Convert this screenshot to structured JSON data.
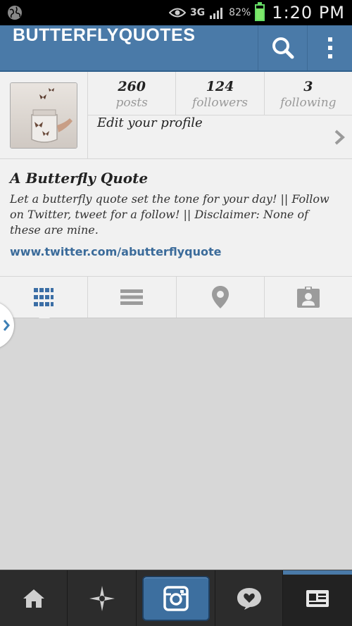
{
  "status_bar": {
    "network": "3G",
    "battery": "82%",
    "battery_level": 0.82,
    "time": "1:20 PM",
    "icons": [
      "globe-icon",
      "eye-icon",
      "signal-icon",
      "battery-icon"
    ]
  },
  "header": {
    "title": "BUTTERFLYQUOTES",
    "color": "#4a7aa8",
    "icons": [
      "search-icon",
      "overflow-menu-icon"
    ]
  },
  "profile": {
    "stats": [
      {
        "value": "260",
        "label": "posts"
      },
      {
        "value": "124",
        "label": "followers"
      },
      {
        "value": "3",
        "label": "following"
      }
    ],
    "edit_label": "Edit your profile",
    "name": "A Butterfly Quote",
    "bio": "Let a butterfly quote set the tone for your day! || Follow on Twitter, tweet for a follow! || Disclaimer: None of these are mine.",
    "link": "www.twitter.com/abutterflyquote"
  },
  "tabs": [
    {
      "icon": "grid-view-icon",
      "active": true
    },
    {
      "icon": "list-view-icon",
      "active": false
    },
    {
      "icon": "map-pin-icon",
      "active": false
    },
    {
      "icon": "tagged-photos-icon",
      "active": false
    }
  ],
  "bottom_nav": [
    {
      "icon": "home-icon"
    },
    {
      "icon": "explore-star-icon"
    },
    {
      "icon": "camera-icon"
    },
    {
      "icon": "activity-heart-bubble-icon"
    },
    {
      "icon": "profile-card-icon",
      "active": true
    }
  ],
  "colors": {
    "accent": "#4a7aa8",
    "link": "#3b6b9a",
    "background": "#d7d7d7"
  }
}
